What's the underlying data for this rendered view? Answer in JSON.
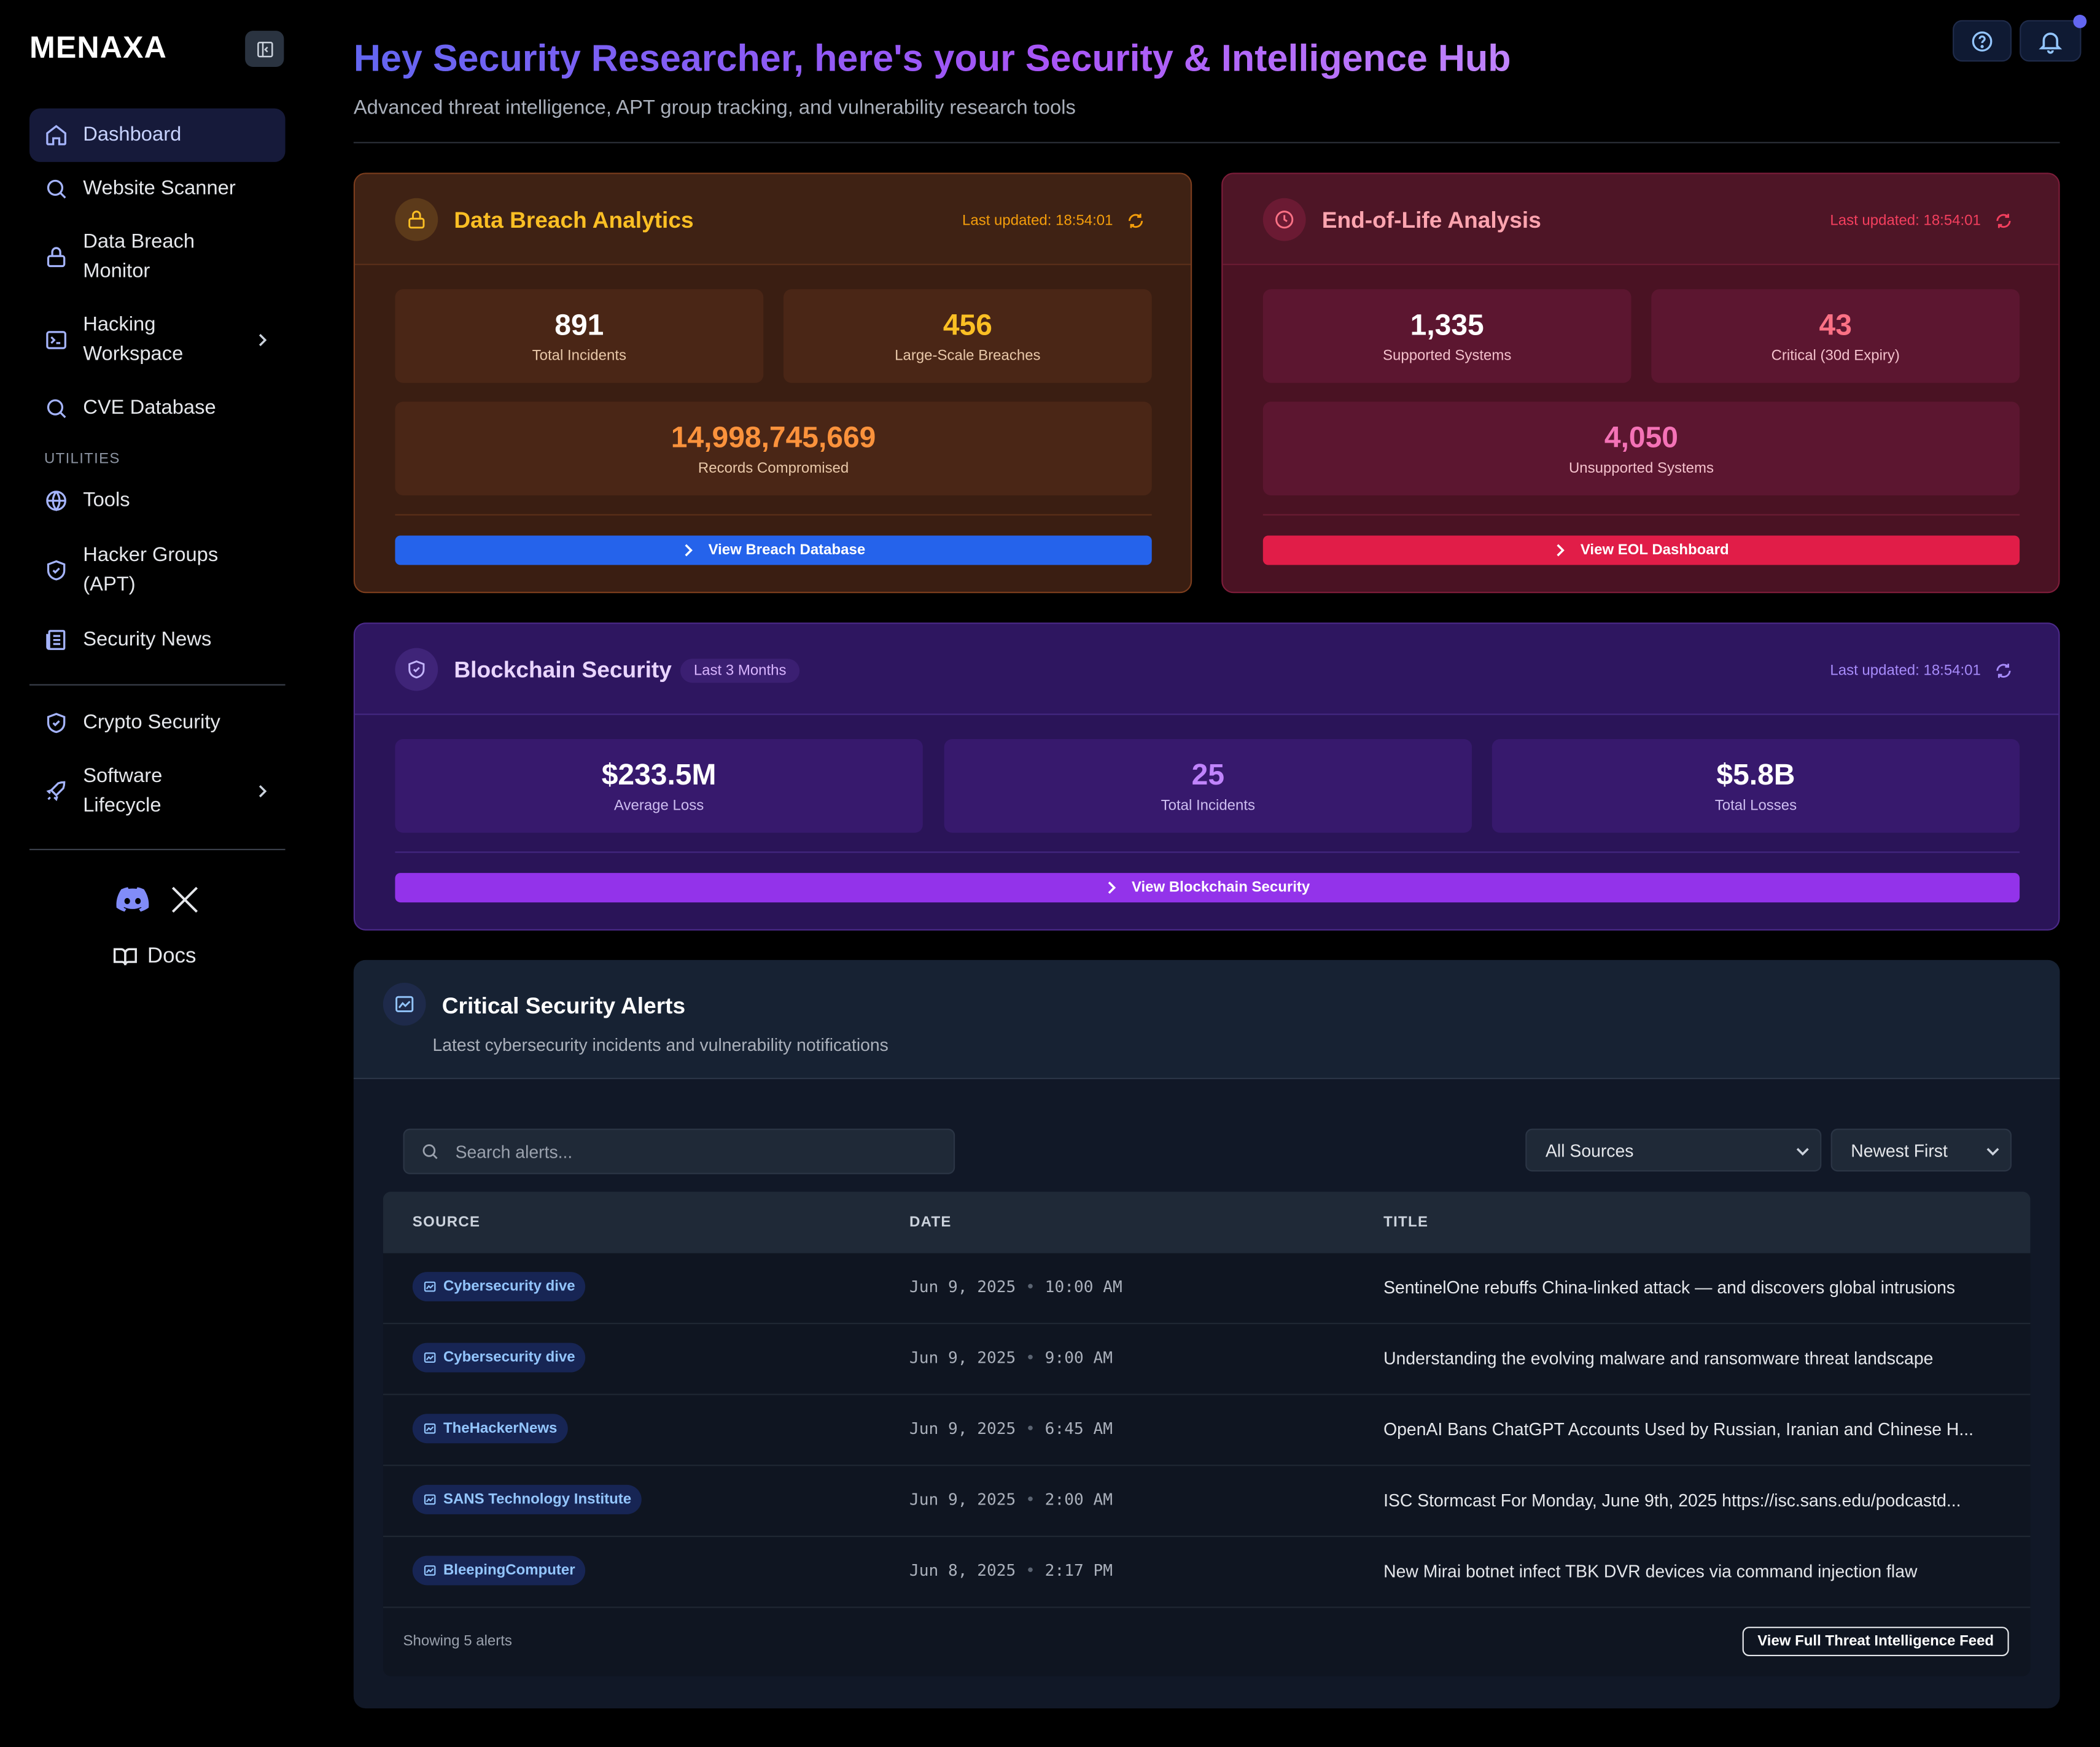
{
  "app": {
    "logo": "MENAXA"
  },
  "sidebar": {
    "items": [
      {
        "label": "Dashboard",
        "icon": "home-icon"
      },
      {
        "label": "Website Scanner",
        "icon": "search-icon"
      },
      {
        "label": "Data Breach Monitor",
        "icon": "lock-icon"
      },
      {
        "label": "Hacking Workspace",
        "icon": "terminal-icon"
      },
      {
        "label": "CVE Database",
        "icon": "search-icon"
      }
    ],
    "utilities_label": "UTILITIES",
    "utilities": [
      {
        "label": "Tools",
        "icon": "globe-icon"
      },
      {
        "label": "Hacker Groups (APT)",
        "icon": "shield-icon"
      },
      {
        "label": "Security News",
        "icon": "newspaper-icon"
      }
    ],
    "extra": [
      {
        "label": "Crypto Security",
        "icon": "shield-icon"
      },
      {
        "label": "Software Lifecycle",
        "icon": "rocket-icon"
      }
    ],
    "docs_label": "Docs"
  },
  "header": {
    "title": "Hey Security Researcher, here's your Security & Intelligence Hub",
    "subtitle": "Advanced threat intelligence, APT group tracking, and vulnerability research tools"
  },
  "breach_card": {
    "title": "Data Breach Analytics",
    "updated": "Last updated: 18:54:01",
    "stats": [
      {
        "value": "891",
        "label": "Total Incidents"
      },
      {
        "value": "456",
        "label": "Large-Scale Breaches"
      },
      {
        "value": "14,998,745,669",
        "label": "Records Compromised"
      }
    ],
    "button": "View Breach Database",
    "accent": "#fbbf24"
  },
  "eol_card": {
    "title": "End-of-Life Analysis",
    "updated": "Last updated: 18:54:01",
    "stats": [
      {
        "value": "1,335",
        "label": "Supported Systems"
      },
      {
        "value": "43",
        "label": "Critical (30d Expiry)"
      },
      {
        "value": "4,050",
        "label": "Unsupported Systems"
      }
    ],
    "button": "View EOL Dashboard",
    "accent": "#e11d48"
  },
  "blockchain_card": {
    "title": "Blockchain Security",
    "badge": "Last 3 Months",
    "updated": "Last updated: 18:54:01",
    "stats": [
      {
        "value": "$233.5M",
        "label": "Average Loss"
      },
      {
        "value": "25",
        "label": "Total Incidents"
      },
      {
        "value": "$5.8B",
        "label": "Total Losses"
      }
    ],
    "button": "View Blockchain Security",
    "accent": "#9333ea"
  },
  "alerts": {
    "title": "Critical Security Alerts",
    "subtitle": "Latest cybersecurity incidents and vulnerability notifications",
    "search_placeholder": "Search alerts...",
    "source_filter": "All Sources",
    "sort": "Newest First",
    "columns": [
      "SOURCE",
      "DATE",
      "TITLE"
    ],
    "rows": [
      {
        "source": "Cybersecurity dive",
        "date": "Jun 9, 2025",
        "time": "10:00 AM",
        "title": "SentinelOne rebuffs China-linked attack — and discovers global intrusions"
      },
      {
        "source": "Cybersecurity dive",
        "date": "Jun 9, 2025",
        "time": "9:00 AM",
        "title": "Understanding the evolving malware and ransomware threat landscape"
      },
      {
        "source": "TheHackerNews",
        "date": "Jun 9, 2025",
        "time": "6:45 AM",
        "title": "OpenAI Bans ChatGPT Accounts Used by Russian, Iranian and Chinese H..."
      },
      {
        "source": "SANS Technology Institute",
        "date": "Jun 9, 2025",
        "time": "2:00 AM",
        "title": "ISC Stormcast For Monday, June 9th, 2025 https://isc.sans.edu/podcastd..."
      },
      {
        "source": "BleepingComputer",
        "date": "Jun 8, 2025",
        "time": "2:17 PM",
        "title": "New Mirai botnet infect TBK DVR devices via command injection flaw"
      }
    ],
    "count_text": "Showing 5 alerts",
    "feed_button": "View Full Threat Intelligence Feed"
  }
}
